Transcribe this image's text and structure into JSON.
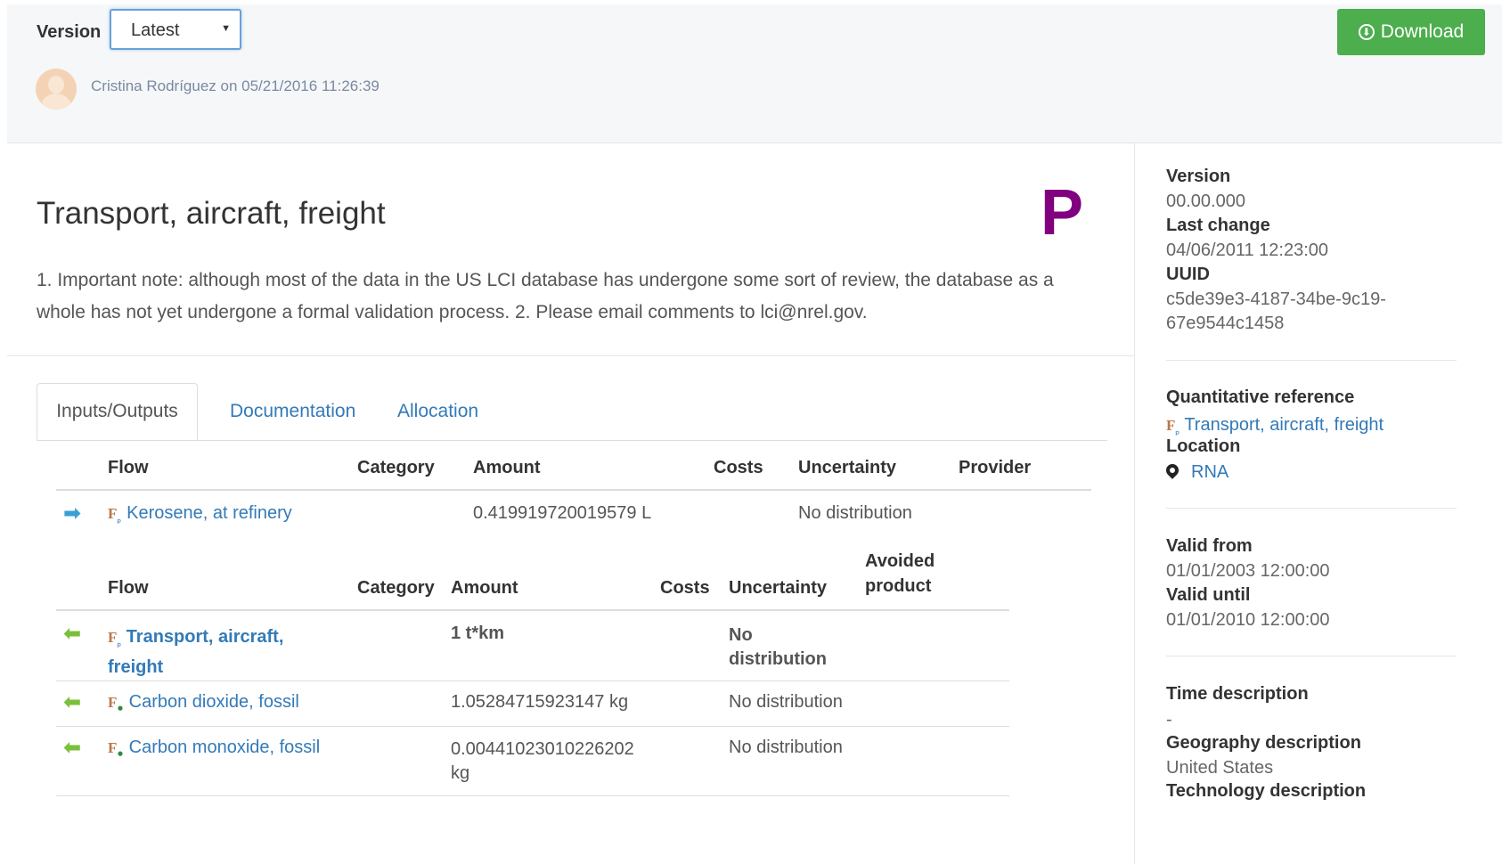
{
  "header": {
    "version_label": "Version",
    "version_selected": "Latest",
    "download_label": "Download",
    "author_line": "Cristina Rodríguez on 05/21/2016 11:26:39"
  },
  "process": {
    "title": "Transport, aircraft, freight",
    "type_letter": "P",
    "description": "1. Important note: although most of the data in the US LCI database has undergone some sort of review, the database as a whole has not yet undergone a formal validation process. 2. Please email comments to lci@nrel.gov."
  },
  "tabs": [
    {
      "label": "Inputs/Outputs",
      "active": true
    },
    {
      "label": "Documentation",
      "active": false
    },
    {
      "label": "Allocation",
      "active": false
    }
  ],
  "inputs": {
    "headers": {
      "flow": "Flow",
      "category": "Category",
      "amount": "Amount",
      "costs": "Costs",
      "uncertainty": "Uncertainty",
      "provider": "Provider"
    },
    "rows": [
      {
        "flow": "Kerosene, at refinery",
        "category": "",
        "amount": "0.419919720019579 L",
        "costs": "",
        "uncertainty": "No distribution",
        "provider": ""
      }
    ]
  },
  "outputs": {
    "headers": {
      "flow": "Flow",
      "category": "Category",
      "amount": "Amount",
      "costs": "Costs",
      "uncertainty": "Uncertainty",
      "avoided": "Avoided product"
    },
    "rows": [
      {
        "flow": "Transport, aircraft, freight",
        "category": "",
        "amount": "1 t*km",
        "costs": "",
        "uncertainty": "No distribution",
        "avoided": ""
      },
      {
        "flow": "Carbon dioxide, fossil",
        "category": "",
        "amount": "1.05284715923147 kg",
        "costs": "",
        "uncertainty": "No distribution",
        "avoided": ""
      },
      {
        "flow": "Carbon monoxide, fossil",
        "category": "",
        "amount": "0.00441023010226202 kg",
        "costs": "",
        "uncertainty": "No distribution",
        "avoided": ""
      }
    ]
  },
  "flow_badge": "F",
  "sidebar": {
    "version_label": "Version",
    "version_value": "00.00.000",
    "last_change_label": "Last change",
    "last_change_value": "04/06/2011 12:23:00",
    "uuid_label": "UUID",
    "uuid_value_1": "c5de39e3-4187-34be-9c19-",
    "uuid_value_2": "67e9544c1458",
    "quant_ref_label": "Quantitative reference",
    "quant_ref_value": "Transport, aircraft, freight",
    "location_label": "Location",
    "location_value": "RNA",
    "valid_from_label": "Valid from",
    "valid_from_value": "01/01/2003 12:00:00",
    "valid_until_label": "Valid until",
    "valid_until_value": "01/01/2010 12:00:00",
    "time_desc_label": "Time description",
    "time_desc_value": "-",
    "geo_desc_label": "Geography description",
    "geo_desc_value": "United States",
    "tech_desc_label": "Technology description"
  }
}
